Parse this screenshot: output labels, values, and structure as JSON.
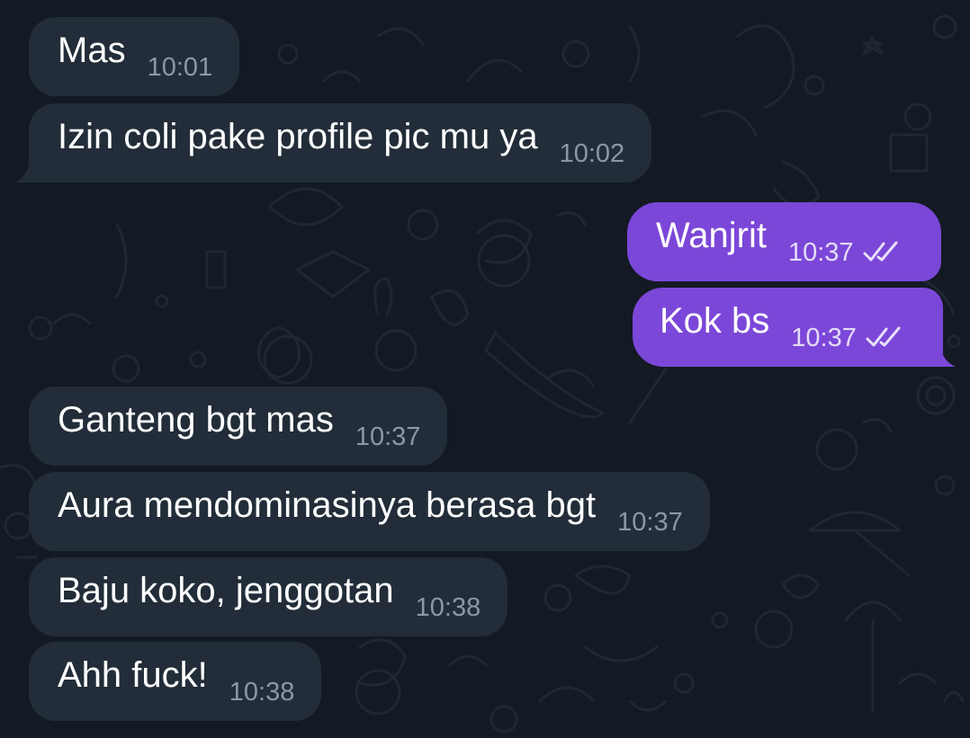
{
  "chat": {
    "messages": [
      {
        "direction": "incoming",
        "text": "Mas",
        "time": "10:01"
      },
      {
        "direction": "incoming",
        "text": "Izin coli pake profile pic mu ya",
        "time": "10:02"
      },
      {
        "direction": "outgoing",
        "text": "Wanjrit",
        "time": "10:37",
        "status": "read"
      },
      {
        "direction": "outgoing",
        "text": "Kok bs",
        "time": "10:37",
        "status": "read"
      },
      {
        "direction": "incoming",
        "text": "Ganteng bgt mas",
        "time": "10:37"
      },
      {
        "direction": "incoming",
        "text": "Aura mendominasinya berasa bgt",
        "time": "10:37"
      },
      {
        "direction": "incoming",
        "text": "Baju koko, jenggotan",
        "time": "10:38"
      },
      {
        "direction": "incoming",
        "text": "Ahh fuck!",
        "time": "10:38"
      }
    ]
  },
  "colors": {
    "background": "#131a24",
    "incoming_bubble": "#222d39",
    "outgoing_bubble": "#7b47d8",
    "text": "#ffffff",
    "time_incoming": "#8a98a6",
    "time_outgoing": "#e4dcf8"
  },
  "icons": {
    "read_status": "double-check-icon"
  }
}
